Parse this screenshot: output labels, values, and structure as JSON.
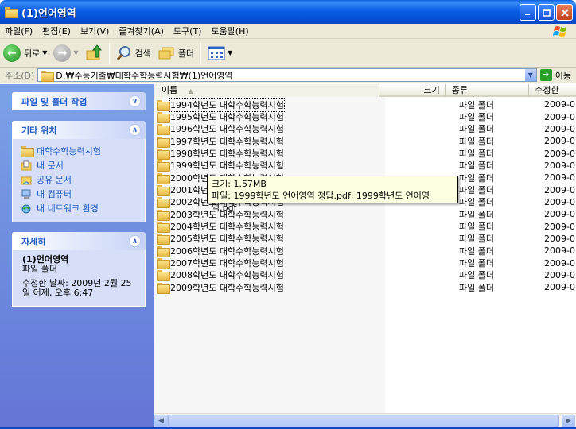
{
  "window": {
    "title": "(1)언어영역"
  },
  "menu": [
    "파일(F)",
    "편집(E)",
    "보기(V)",
    "즐겨찾기(A)",
    "도구(T)",
    "도움말(H)"
  ],
  "toolbar": {
    "back_label": "뒤로",
    "search_label": "검색",
    "folders_label": "폴더"
  },
  "address": {
    "label": "주소(D)",
    "path": "D:₩수능기출₩대학수학능력시험₩(1)언어영역",
    "go_label": "이동"
  },
  "left": {
    "tasks_title": "파일 및 폴더 작업",
    "other_title": "기타 위치",
    "other_links": [
      "대학수학능력시험",
      "내 문서",
      "공유 문서",
      "내 컴퓨터",
      "내 네트워크 환경"
    ],
    "details_title": "자세히",
    "details_name": "(1)언어영역",
    "details_type": "파일 폴더",
    "details_date_1": "수정한 날짜: 2009년 2월 25",
    "details_date_2": "일 어제, 오후 6:47"
  },
  "list": {
    "columns": {
      "name": "이름",
      "size": "크기",
      "type": "종류",
      "date": "수정한"
    },
    "rows": [
      {
        "name": "1994학년도 대학수학능력시험",
        "type": "파일 폴더",
        "date": "2009-0"
      },
      {
        "name": "1995학년도 대학수학능력시험",
        "type": "파일 폴더",
        "date": "2009-0"
      },
      {
        "name": "1996학년도 대학수학능력시험",
        "type": "파일 폴더",
        "date": "2009-0"
      },
      {
        "name": "1997학년도 대학수학능력시험",
        "type": "파일 폴더",
        "date": "2009-0"
      },
      {
        "name": "1998학년도 대학수학능력시험",
        "type": "파일 폴더",
        "date": "2009-0"
      },
      {
        "name": "1999학년도 대학수학능력시험",
        "type": "파일 폴더",
        "date": "2009-0"
      },
      {
        "name": "2000학년도 대학수학능력시험",
        "type": "파일 폴더",
        "date": "2009-0"
      },
      {
        "name": "2001학년도 대학수학능력시험",
        "type": "파일 폴더",
        "date": "2009-0"
      },
      {
        "name": "2002학년도 대학수학능력시험",
        "type": "파일 폴더",
        "date": "2009-0"
      },
      {
        "name": "2003학년도 대학수학능력시험",
        "type": "파일 폴더",
        "date": "2009-0"
      },
      {
        "name": "2004학년도 대학수학능력시험",
        "type": "파일 폴더",
        "date": "2009-0"
      },
      {
        "name": "2005학년도 대학수학능력시험",
        "type": "파일 폴더",
        "date": "2009-0"
      },
      {
        "name": "2006학년도 대학수학능력시험",
        "type": "파일 폴더",
        "date": "2009-0"
      },
      {
        "name": "2007학년도 대학수학능력시험",
        "type": "파일 폴더",
        "date": "2009-0"
      },
      {
        "name": "2008학년도 대학수학능력시험",
        "type": "파일 폴더",
        "date": "2009-0"
      },
      {
        "name": "2009학년도 대학수학능력시험",
        "type": "파일 폴더",
        "date": "2009-0"
      }
    ]
  },
  "tooltip": {
    "line1": "크기: 1.57MB",
    "line2": "파일: 1999학년도 언어영역 정답.pdf, 1999학년도 언어영역.pdf"
  },
  "colors": {
    "title_bar": "#0b5de6",
    "task_pane": "#7ba2e7",
    "link": "#215dc6",
    "tooltip_bg": "#ffffe1"
  }
}
